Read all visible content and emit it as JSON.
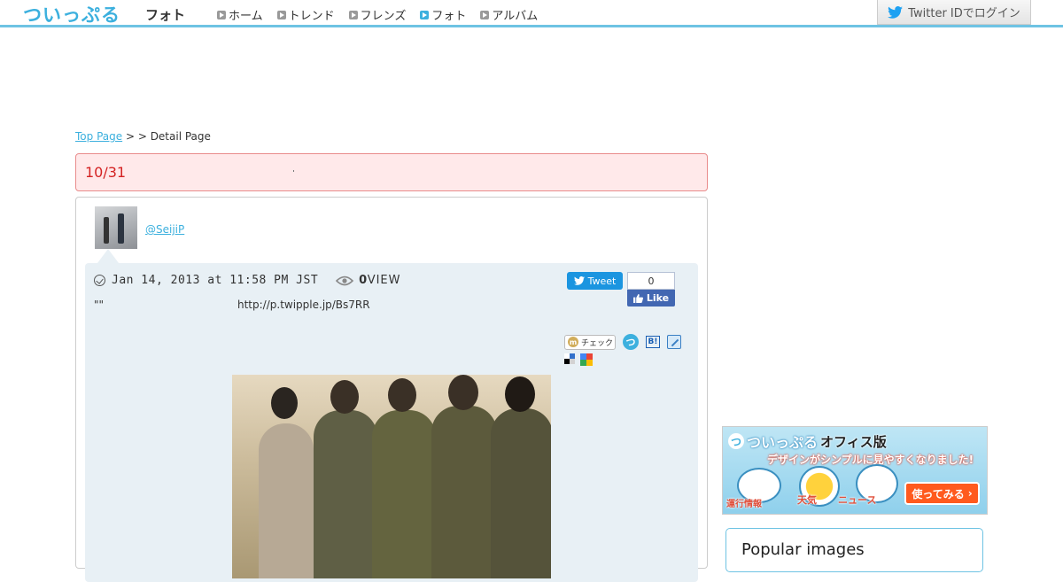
{
  "header": {
    "logo": "ついっぷる",
    "section": "フォト",
    "nav": [
      {
        "label": "ホーム",
        "active": false
      },
      {
        "label": "トレンド",
        "active": false
      },
      {
        "label": "フレンズ",
        "active": false
      },
      {
        "label": "フォト",
        "active": true
      },
      {
        "label": "アルバム",
        "active": false
      }
    ],
    "login_label": "Twitter IDでログイン"
  },
  "breadcrumb": {
    "top_page": "Top Page",
    "sep1": " > ",
    "sep2": " > ",
    "detail": "Detail Page"
  },
  "title": "10/31",
  "post": {
    "username": "@SeijiP",
    "timestamp": "Jan 14, 2013 at 11:58 PM JST",
    "view_count": "0",
    "view_label": "VIEW",
    "text": "\"\"",
    "url": "http://p.twipple.jp/Bs7RR"
  },
  "share": {
    "tweet_label": "Tweet",
    "like_count": "0",
    "like_label": "Like",
    "mixi_label": "チェック",
    "mixi_icon": "m",
    "twipple_icon": "つ",
    "hatena_label": "B!"
  },
  "banner": {
    "logo": "ついっぷる",
    "logo_icon": "つ",
    "edition": "オフィス版",
    "subtitle": "デザインがシンプルに見やすくなりました!",
    "label_train": "運行情報",
    "label_weather": "天気",
    "label_news": "ニュース",
    "cta": "使ってみる"
  },
  "popular": {
    "title": "Popular images"
  },
  "colors": {
    "accent": "#3cb0de",
    "title_bg": "#ffe9ea",
    "title_text": "#d42222",
    "tweet_blue": "#1b95e0",
    "facebook_blue": "#4267b2"
  }
}
